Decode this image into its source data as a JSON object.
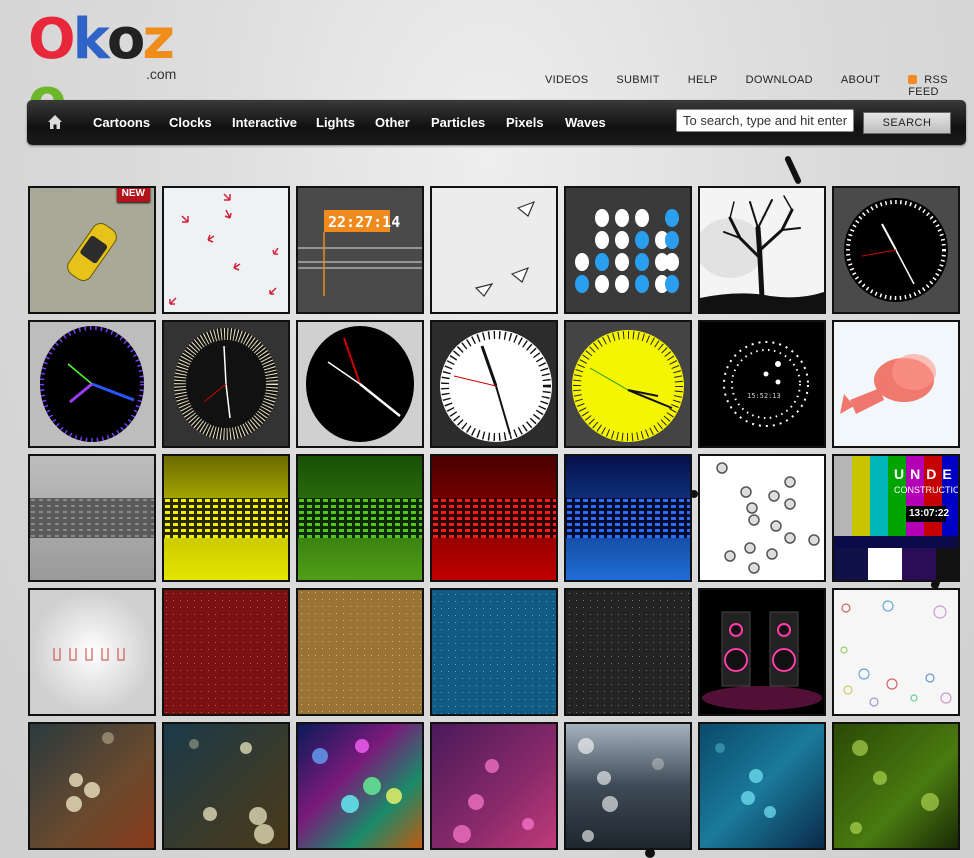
{
  "logo": {
    "letters": [
      "O",
      "k",
      "o",
      "z",
      "o"
    ],
    "sub": ".com"
  },
  "toplinks": [
    "VIDEOS",
    "SUBMIT",
    "HELP",
    "DOWNLOAD",
    "ABOUT"
  ],
  "rss_label": "RSS FEED",
  "nav": {
    "items": [
      "Cartoons",
      "Clocks",
      "Interactive",
      "Lights",
      "Other",
      "Particles",
      "Pixels",
      "Waves"
    ],
    "search_value": "To search, type and hit enter",
    "search_button": "SEARCH"
  },
  "tiles": {
    "new_badge": "NEW",
    "digital_time": "22:27:14",
    "dot_clock_time": "15:52:13",
    "under_title": "UNDER",
    "under_sub": "CONSTRUCTION",
    "under_time": "13:07:22"
  },
  "colors": {
    "accent_red": "#b3141b",
    "rss": "#f48a20",
    "nav_bg": "#1b1b1b"
  }
}
